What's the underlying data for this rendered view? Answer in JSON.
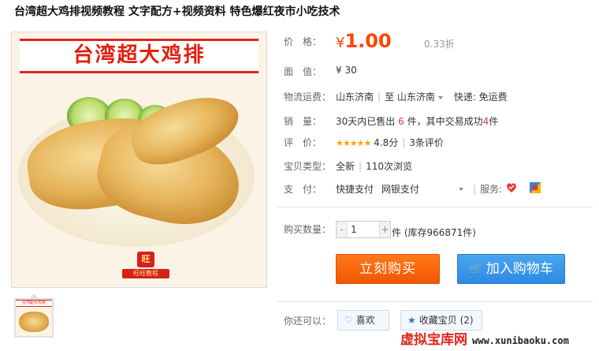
{
  "title": "台湾超大鸡排视频教程 文字配方+视频资料 特色爆红夜市小吃技术",
  "image": {
    "banner_text": "台湾超大鸡排",
    "stamp_top": "旺",
    "stamp_bottom": "旺旺教程"
  },
  "price": {
    "label": "价　格：",
    "currency": "¥",
    "value": "1.00",
    "discount": "0.33折"
  },
  "face_value": {
    "label": "面　值：",
    "value": "¥ 30"
  },
  "shipping": {
    "label": "物流运费：",
    "from": "山东济南",
    "to_word": "至",
    "to": "山东济南",
    "express": "快递: 免运费"
  },
  "sales": {
    "label": "销　量：",
    "prefix": "30天内已售出",
    "count": "6",
    "mid": "件，其中交易成功",
    "success": "4",
    "suffix": "件"
  },
  "rating": {
    "label": "评　价：",
    "stars": "★★★★★",
    "score": "4.8分",
    "reviews": "3条评价"
  },
  "item_type": {
    "label": "宝贝类型：",
    "condition": "全新",
    "views": "110次浏览"
  },
  "payment": {
    "label": "支　付：",
    "method1": "快捷支付",
    "method2": "网银支付",
    "service_label": "服务:"
  },
  "quantity": {
    "label": "购买数量：",
    "minus": "-",
    "value": "1",
    "plus": "+",
    "stock": "件 (库存966871件)"
  },
  "buttons": {
    "buy": "立刻购买",
    "cart": "加入购物车",
    "like": "喜欢",
    "favorite": "收藏宝贝 (2)",
    "also_label": "你还可以："
  },
  "watermark": {
    "cn": "虚拟宝库网",
    "en": "www.xunibaoku.com"
  },
  "colors": {
    "price": "#ff4400",
    "buy": "#f25600",
    "cart": "#2c8ae3",
    "accent_red": "#e4393c"
  }
}
